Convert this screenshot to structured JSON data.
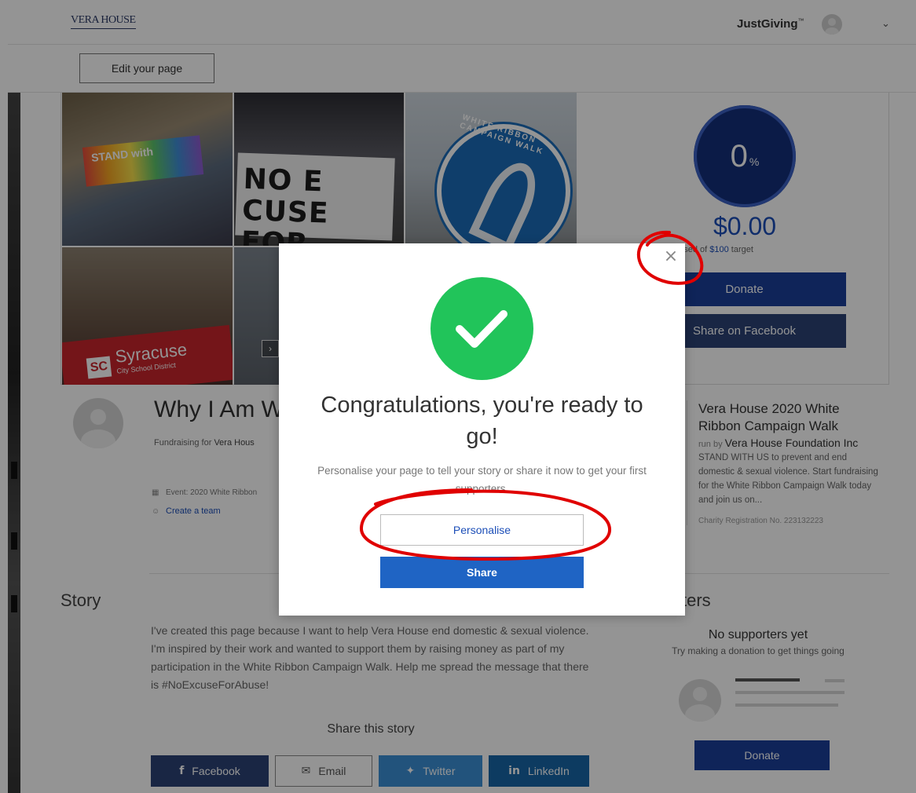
{
  "header": {
    "logo_text": "VERA HOUSE",
    "brand": "JustGiving",
    "brand_mark": "™"
  },
  "toolbar": {
    "edit_label": "Edit your page"
  },
  "hero": {
    "photo_sign": "NO E CUSE\nFOR ABUSE",
    "photo_banner": "STAND with",
    "photo_badge": "WHITE RIBBON CAMPAIGN WALK",
    "photo_school": "Syracuse",
    "photo_school_sub": "City School District",
    "photo_logo": "SC"
  },
  "progress": {
    "percent": "0",
    "percent_sign": "%",
    "raised": "$0.00",
    "target_prefix": "raised of ",
    "target_amount": "$100",
    "target_suffix": " target",
    "donate_label": "Donate",
    "share_fb_label": "Share on Facebook"
  },
  "profile": {
    "title": "Why I Am W",
    "fundraising_prefix": "Fundraising for ",
    "fundraising_for": "Vera Hous",
    "event_line": "Event: 2020 White Ribbon",
    "create_team": "Create a team"
  },
  "event": {
    "name": "Vera House 2020 White Ribbon Campaign Walk",
    "run_by_prefix": "run by ",
    "run_by": "Vera House Foundation Inc",
    "description": "STAND WITH US to prevent and end domestic & sexual violence. Start fundraising for the White Ribbon Campaign Walk today and join us on...",
    "charity_no": "Charity Registration No. 223132223"
  },
  "story": {
    "heading": "Story",
    "text": "I've created this page because I want to help Vera House end domestic & sexual violence. I'm inspired by their work and wanted to support them by raising money as part of my participation in the White Ribbon Campaign Walk. Help me spread the message that there is #NoExcuseForAbuse!",
    "share_heading": "Share this story",
    "share_buttons": {
      "facebook": "Facebook",
      "email": "Email",
      "twitter": "Twitter",
      "linkedin": "LinkedIn"
    }
  },
  "supporters": {
    "heading": "ters",
    "empty_title": "No supporters yet",
    "empty_sub": "Try making a donation to get things going",
    "donate_label": "Donate"
  },
  "modal": {
    "close_glyph": "×",
    "title": "Congratulations, you're ready to go!",
    "subtitle": "Personalise your page to tell your story or share it now to get your first supporters.",
    "personalise_label": "Personalise",
    "share_label": "Share"
  },
  "colors": {
    "primary_blue": "#1f64c4",
    "dark_blue": "#1a3f9a",
    "success_green": "#21c45a",
    "annotation_red": "#e00000"
  }
}
